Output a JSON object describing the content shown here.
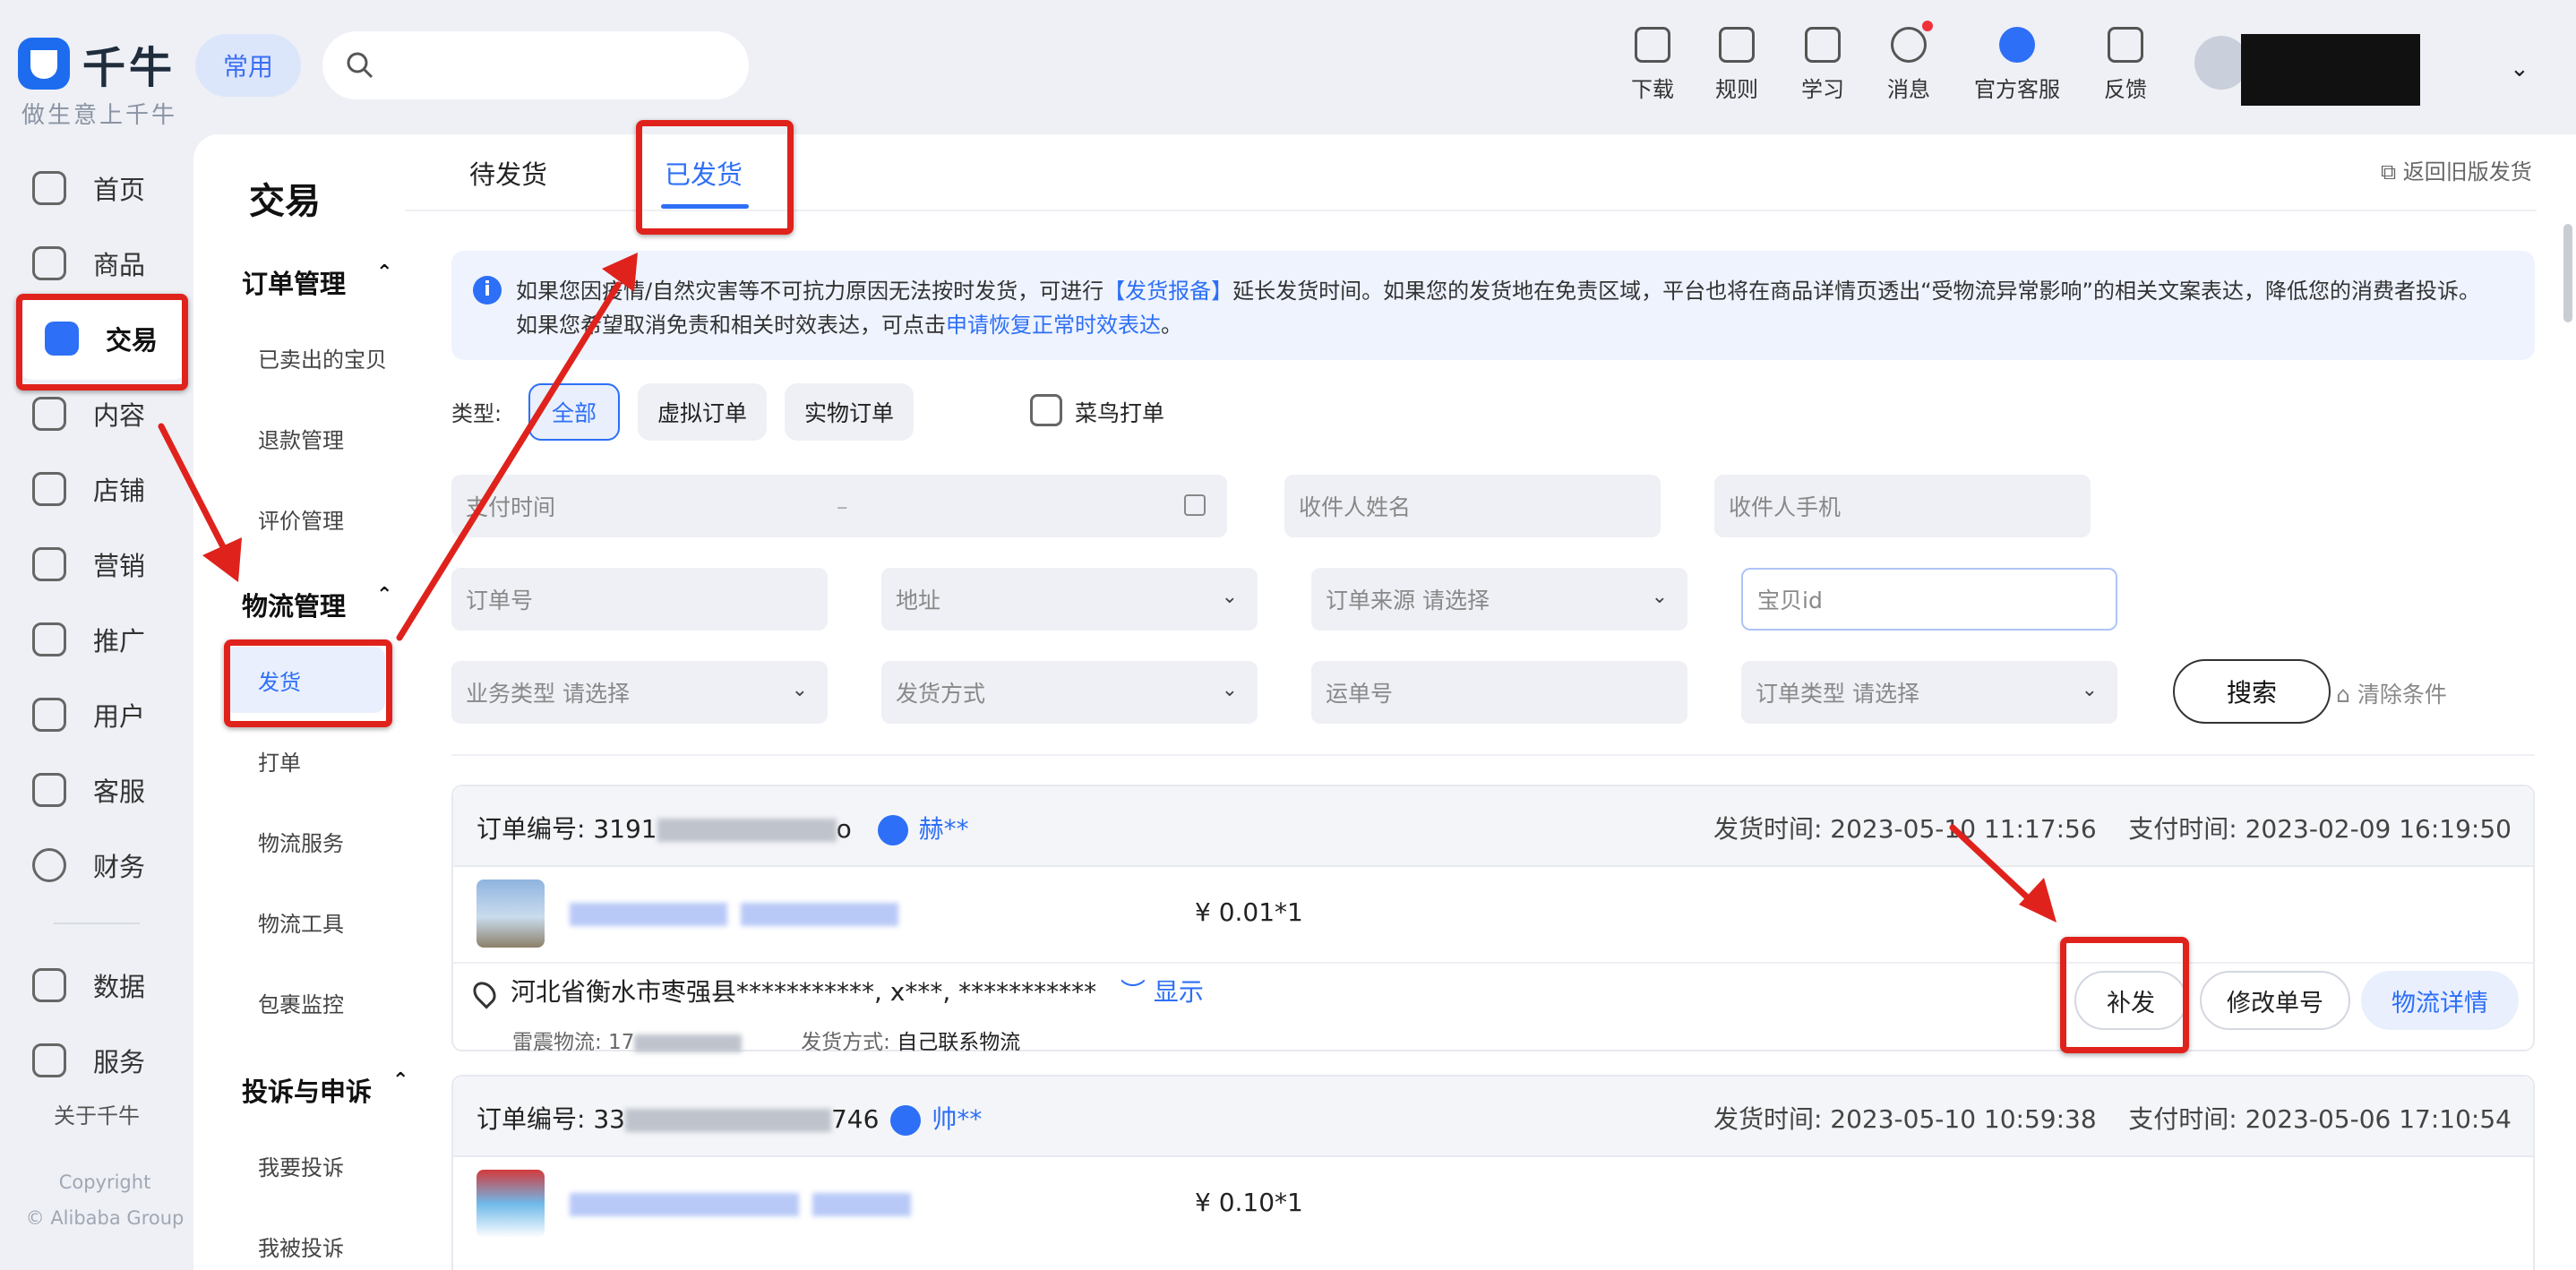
{
  "app": {
    "logo": "千牛",
    "slogan": "做生意上千牛",
    "common_label": "常用",
    "search_placeholder": ""
  },
  "toolbar": [
    {
      "label": "下载",
      "icon": "download-icon"
    },
    {
      "label": "规则",
      "icon": "rules-icon"
    },
    {
      "label": "学习",
      "icon": "learn-icon"
    },
    {
      "label": "消息",
      "icon": "message-icon"
    },
    {
      "label": "官方客服",
      "icon": "official-service-icon"
    },
    {
      "label": "反馈",
      "icon": "feedback-icon"
    }
  ],
  "nav": {
    "items": [
      {
        "label": "首页",
        "icon": "home-icon"
      },
      {
        "label": "商品",
        "icon": "goods-icon"
      },
      {
        "label": "交易",
        "icon": "trade-icon",
        "active": true
      },
      {
        "label": "内容",
        "icon": "content-icon"
      },
      {
        "label": "店铺",
        "icon": "shop-icon"
      },
      {
        "label": "营销",
        "icon": "marketing-icon"
      },
      {
        "label": "推广",
        "icon": "promotion-icon"
      },
      {
        "label": "用户",
        "icon": "user-icon"
      },
      {
        "label": "客服",
        "icon": "service-icon"
      },
      {
        "label": "财务",
        "icon": "finance-icon"
      },
      {
        "label": "数据",
        "icon": "data-icon"
      },
      {
        "label": "服务",
        "icon": "apps-icon"
      }
    ],
    "about": "关于千牛",
    "copyright_1": "Copyright",
    "copyright_2": "© Alibaba Group"
  },
  "subnav": {
    "title": "交易",
    "groups": [
      {
        "label": "订单管理",
        "items": [
          "已卖出的宝贝",
          "退款管理",
          "评价管理"
        ]
      },
      {
        "label": "物流管理",
        "items": [
          "发货",
          "打单",
          "物流服务",
          "物流工具",
          "包裹监控"
        ]
      },
      {
        "label": "投诉与申诉",
        "items": [
          "我要投诉",
          "我被投诉"
        ]
      }
    ]
  },
  "tabs": [
    {
      "label": "待发货"
    },
    {
      "label": "已发货",
      "active": true
    }
  ],
  "return_link": "返回旧版发货",
  "notice": {
    "line1_a": "如果您因疫情/自然灾害等不可抗力原因无法按时发货，可进行",
    "line1_link": "【发货报备】",
    "line1_b": "延长发货时间。如果您的发货地在免责区域，平台也将在商品详情页透出“受物流异常影响”的相关文案表达，降低您的消费者投诉。",
    "line2_a": "如果您希望取消免责和相关时效表达，可点击",
    "line2_link": "申请恢复正常时效表达",
    "line2_b": "。"
  },
  "filters": {
    "type_label": "类型:",
    "type_options": [
      "全部",
      "虚拟订单",
      "实物订单"
    ],
    "cainiao_label": "菜鸟打单",
    "pay_time": "支付时间",
    "range_sep": "–",
    "receiver_name": "收件人姓名",
    "receiver_phone": "收件人手机",
    "order_no": "订单号",
    "address": "地址",
    "order_source": "订单来源   请选择",
    "item_id": "宝贝id",
    "biz_type": "业务类型   请选择",
    "ship_method": "发货方式",
    "waybill": "运单号",
    "order_type": "订单类型   请选择",
    "search_btn": "搜索",
    "clear_btn": "清除条件"
  },
  "orders": [
    {
      "no_label": "订单编号:",
      "no_prefix": "3191",
      "no_suffix": "o",
      "buyer": "赫**",
      "ship_time": "发货时间: 2023-05-10 11:17:56",
      "pay_time": "支付时间: 2023-02-09 16:19:50",
      "price": "¥ 0.01*1",
      "address": "河北省衡水市枣强县***********, x***, ***********",
      "show": "显示",
      "carrier_label": "雷震物流: 17",
      "ship_method": "发货方式:",
      "ship_method_value": "自己联系物流",
      "buttons": [
        "补发",
        "修改单号",
        "物流详情"
      ]
    },
    {
      "no_label": "订单编号:",
      "no_prefix": "33",
      "no_suffix": "746",
      "buyer": "帅**",
      "ship_time": "发货时间: 2023-05-10 10:59:38",
      "pay_time": "支付时间: 2023-05-06 17:10:54",
      "price": "¥ 0.10*1"
    }
  ],
  "colors": {
    "accent": "#2d6ff6",
    "annotation": "#e0221c",
    "background": "#eef0f5"
  }
}
